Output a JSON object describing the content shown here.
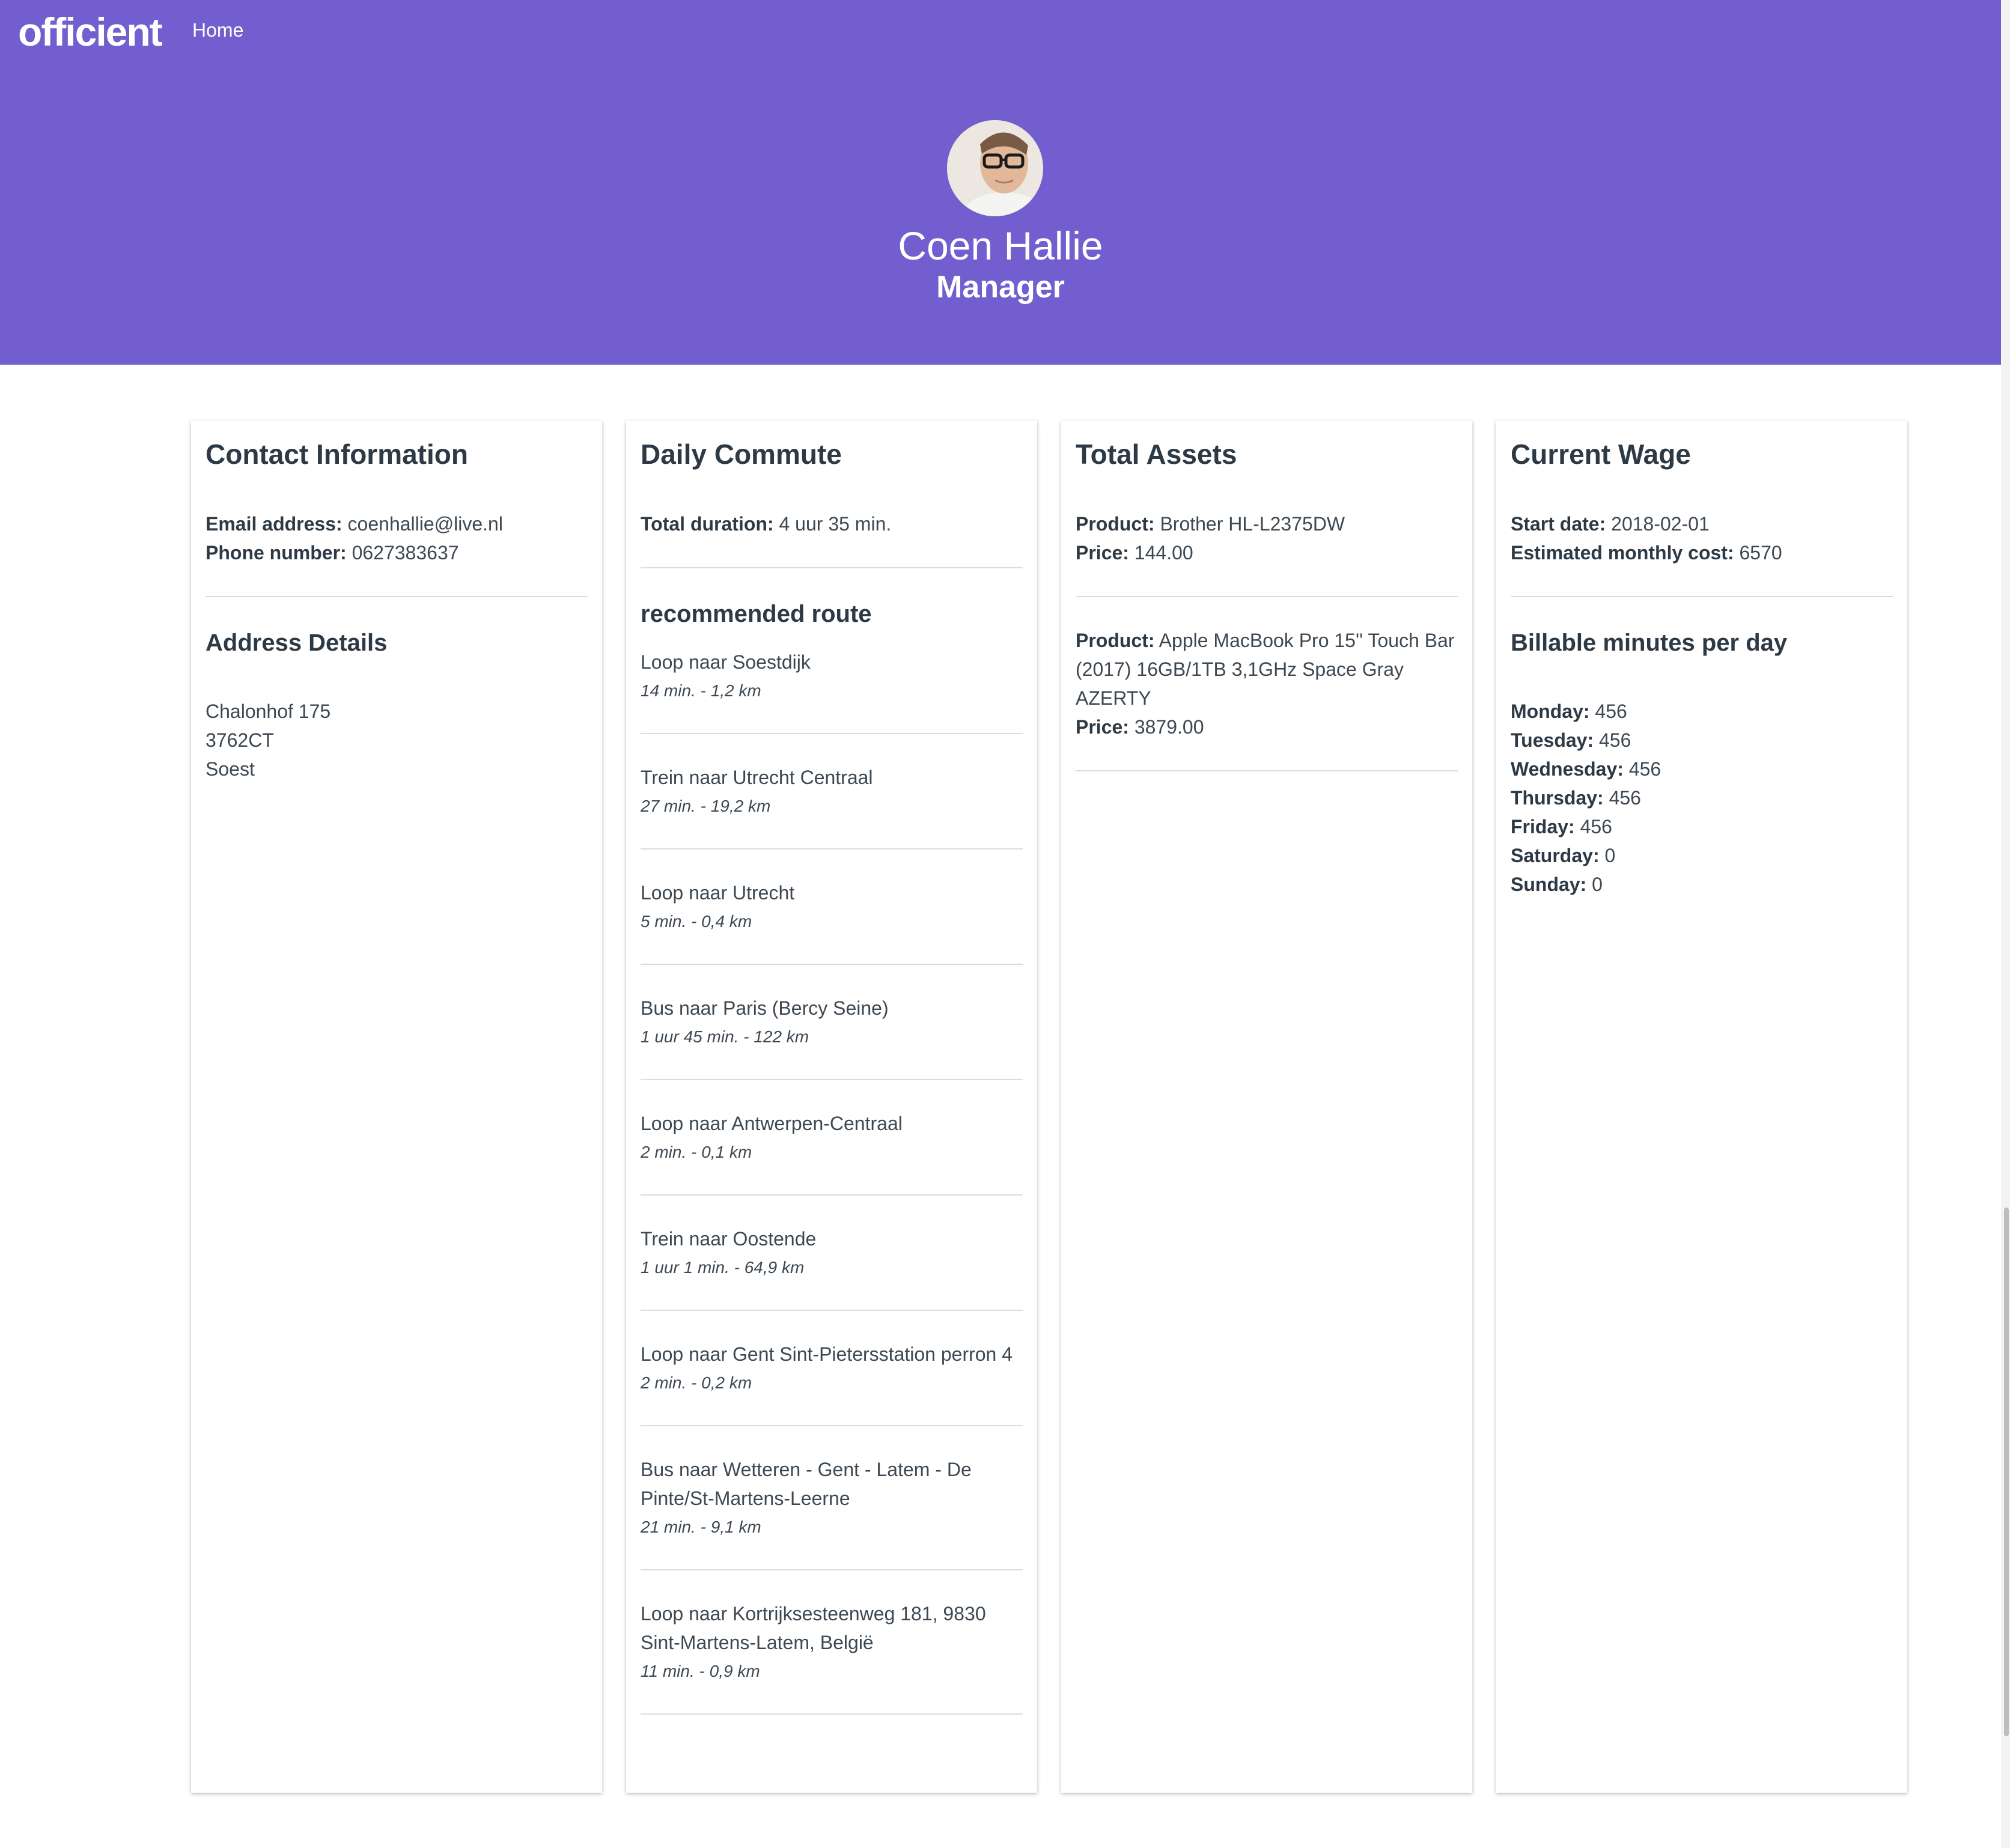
{
  "brand": {
    "logo": "officient"
  },
  "nav": {
    "home_label": "Home"
  },
  "profile": {
    "name": "Coen Hallie",
    "role": "Manager",
    "avatar_icon": "avatar-photo"
  },
  "contact": {
    "title": "Contact Information",
    "email_label": "Email address:",
    "email_value": "coenhallie@live.nl",
    "phone_label": "Phone number:",
    "phone_value": "0627383637",
    "address_title": "Address Details",
    "address_lines": [
      "Chalonhof 175",
      "3762CT",
      "Soest"
    ]
  },
  "commute": {
    "title": "Daily Commute",
    "duration_label": "Total duration:",
    "duration_value": "4 uur 35 min.",
    "route_title": "recommended route",
    "routes": [
      {
        "title": "Loop naar Soestdijk",
        "meta": "14 min. - 1,2 km"
      },
      {
        "title": "Trein naar Utrecht Centraal",
        "meta": "27 min. - 19,2 km"
      },
      {
        "title": "Loop naar Utrecht",
        "meta": "5 min. - 0,4 km"
      },
      {
        "title": "Bus naar Paris (Bercy Seine)",
        "meta": "1 uur 45 min. - 122 km"
      },
      {
        "title": "Loop naar Antwerpen-Centraal",
        "meta": "2 min. - 0,1 km"
      },
      {
        "title": "Trein naar Oostende",
        "meta": "1 uur 1 min. - 64,9 km"
      },
      {
        "title": "Loop naar Gent Sint-Pietersstation perron 4",
        "meta": "2 min. - 0,2 km"
      },
      {
        "title": "Bus naar Wetteren - Gent - Latem - De Pinte/St-Martens-Leerne",
        "meta": "21 min. - 9,1 km"
      },
      {
        "title": "Loop naar Kortrijksesteenweg 181, 9830 Sint-Martens-Latem, België",
        "meta": "11 min. - 0,9 km"
      }
    ]
  },
  "assets": {
    "title": "Total Assets",
    "product_label": "Product:",
    "price_label": "Price:",
    "items": [
      {
        "product": "Brother HL-L2375DW",
        "price": "144.00"
      },
      {
        "product": "Apple MacBook Pro 15'' Touch Bar (2017) 16GB/1TB 3,1GHz Space Gray AZERTY",
        "price": "3879.00"
      }
    ]
  },
  "wage": {
    "title": "Current Wage",
    "start_label": "Start date:",
    "start_value": "2018-02-01",
    "cost_label": "Estimated monthly cost:",
    "cost_value": "6570",
    "billable_title": "Billable minutes per day",
    "days": [
      {
        "label": "Monday:",
        "value": "456"
      },
      {
        "label": "Tuesday:",
        "value": "456"
      },
      {
        "label": "Wednesday:",
        "value": "456"
      },
      {
        "label": "Thursday:",
        "value": "456"
      },
      {
        "label": "Friday:",
        "value": "456"
      },
      {
        "label": "Saturday:",
        "value": "0"
      },
      {
        "label": "Sunday:",
        "value": "0"
      }
    ]
  },
  "colors": {
    "header_bg": "#725ecf",
    "text": "#2d3a45"
  }
}
